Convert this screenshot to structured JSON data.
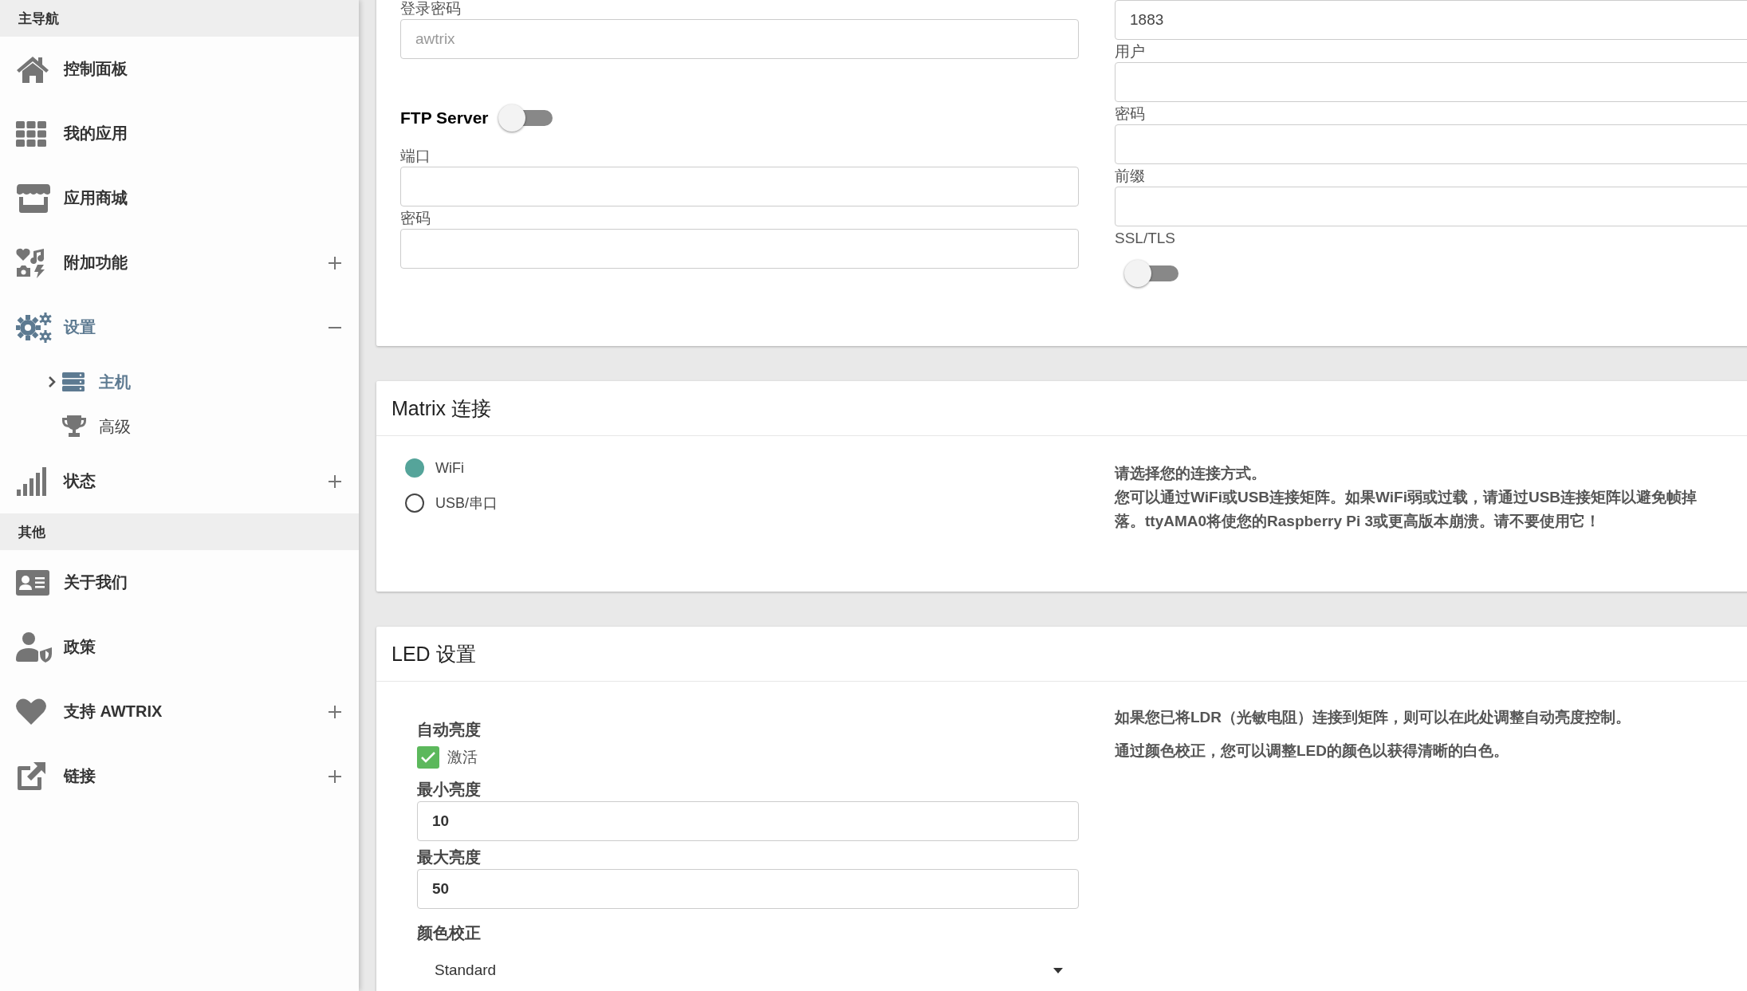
{
  "sidebar": {
    "sections": [
      {
        "heading": "主导航",
        "items": [
          {
            "label": "控制面板",
            "selected": false
          },
          {
            "label": "我的应用",
            "selected": false
          },
          {
            "label": "应用商城",
            "selected": false
          },
          {
            "label": "附加功能",
            "selected": false,
            "expanded": false
          },
          {
            "label": "设置",
            "selected": true,
            "expanded": true,
            "children": [
              {
                "label": "主机",
                "selected": true
              },
              {
                "label": "高级",
                "selected": false
              }
            ]
          },
          {
            "label": "状态",
            "selected": false,
            "expanded": false
          }
        ]
      },
      {
        "heading": "其他",
        "items": [
          {
            "label": "关于我们",
            "selected": false
          },
          {
            "label": "政策",
            "selected": false
          },
          {
            "label": "支持 AWTRIX",
            "selected": false,
            "expanded": false
          },
          {
            "label": "链接",
            "selected": false,
            "expanded": false
          }
        ]
      }
    ]
  },
  "upper_card": {
    "login_password": {
      "label": "登录密码",
      "placeholder": "awtrix"
    },
    "ftp_server": {
      "label": "FTP Server",
      "on": false
    },
    "ftp_fields": [
      {
        "label": "端口"
      },
      {
        "label": "密码"
      }
    ],
    "port_field": {
      "value": "1883"
    },
    "broker_fields": [
      {
        "label": "用户"
      },
      {
        "label": "密码"
      },
      {
        "label": "前缀"
      }
    ],
    "ssl_tls": {
      "label": "SSL/TLS",
      "on": false
    }
  },
  "matrix_card": {
    "title": "Matrix 连接",
    "options": [
      {
        "label": "WiFi",
        "selected": true
      },
      {
        "label": "USB/串口",
        "selected": false
      }
    ],
    "help_lines": [
      "请选择您的连接方式。",
      "您可以通过WiFi或USB连接矩阵。如果WiFi弱或过载，请通过USB连接矩阵以避免帧掉",
      "落。ttyAMA0将使您的Raspberry Pi 3或更高版本崩溃。请不要使用它！"
    ]
  },
  "led_card": {
    "title": "LED 设置",
    "auto_brightness": {
      "label": "自动亮度",
      "checkbox_label": "激活",
      "checked": true
    },
    "fields": [
      {
        "label": "最小亮度",
        "value": "10"
      },
      {
        "label": "最大亮度",
        "value": "50"
      }
    ],
    "color_correction": {
      "label": "颜色校正",
      "value": "Standard"
    },
    "help": [
      "如果您已将LDR（光敏电阻）连接到矩阵，则可以在此处调整自动亮度控制。",
      "通过颜色校正，您可以调整LED的颜色以获得清晰的白色。"
    ]
  }
}
